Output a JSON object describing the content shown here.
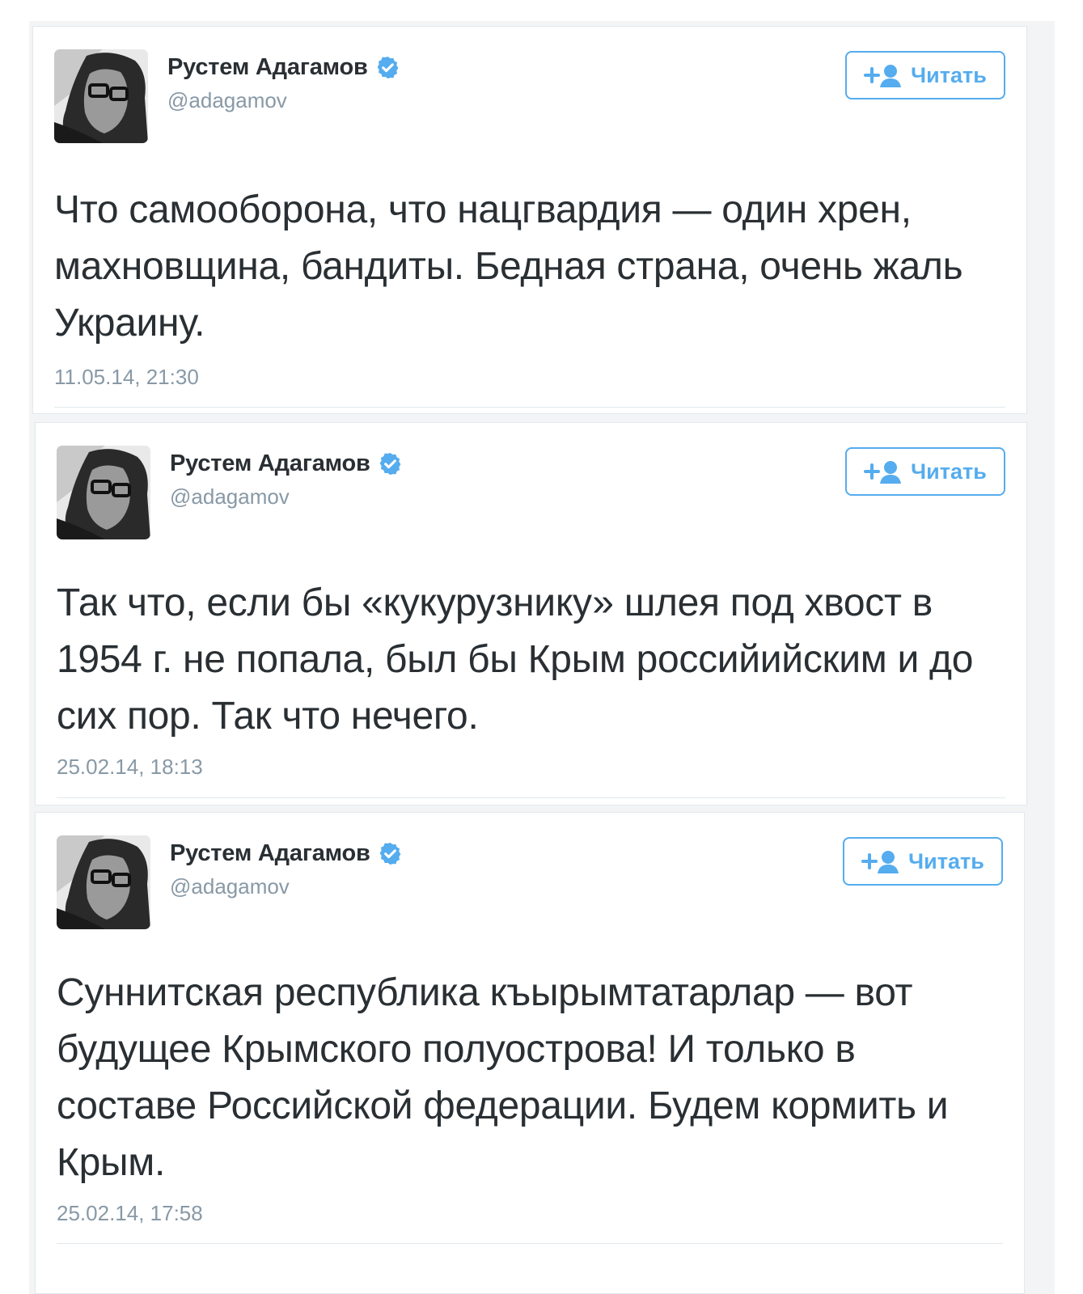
{
  "colors": {
    "accent": "#55acee",
    "text": "#292f33",
    "muted": "#8899a6",
    "background": "#f3f4f5"
  },
  "tweets": [
    {
      "author": {
        "name": "Рустем Адагамов",
        "handle": "@adagamov",
        "verified": true
      },
      "follow_label": "Читать",
      "text": "Что самооборона, что нацгвардия — один хрен, махновщина, бандиты. Бедная страна, очень жаль Украину.",
      "timestamp": "11.05.14, 21:30"
    },
    {
      "author": {
        "name": "Рустем Адагамов",
        "handle": "@adagamov",
        "verified": true
      },
      "follow_label": "Читать",
      "text": "Так что, если бы «кукурузнику» шлея под хвост в 1954 г. не попала, был бы Крым российийским и до сих пор. Так что нечего.",
      "timestamp": "25.02.14, 18:13"
    },
    {
      "author": {
        "name": "Рустем Адагамов",
        "handle": "@adagamov",
        "verified": true
      },
      "follow_label": "Читать",
      "text": "Суннитская республика къырымтатарлар — вот будущее Крымского полуострова! И только в составе Российской федерации. Будем кормить и Крым.",
      "timestamp": "25.02.14, 17:58"
    }
  ]
}
